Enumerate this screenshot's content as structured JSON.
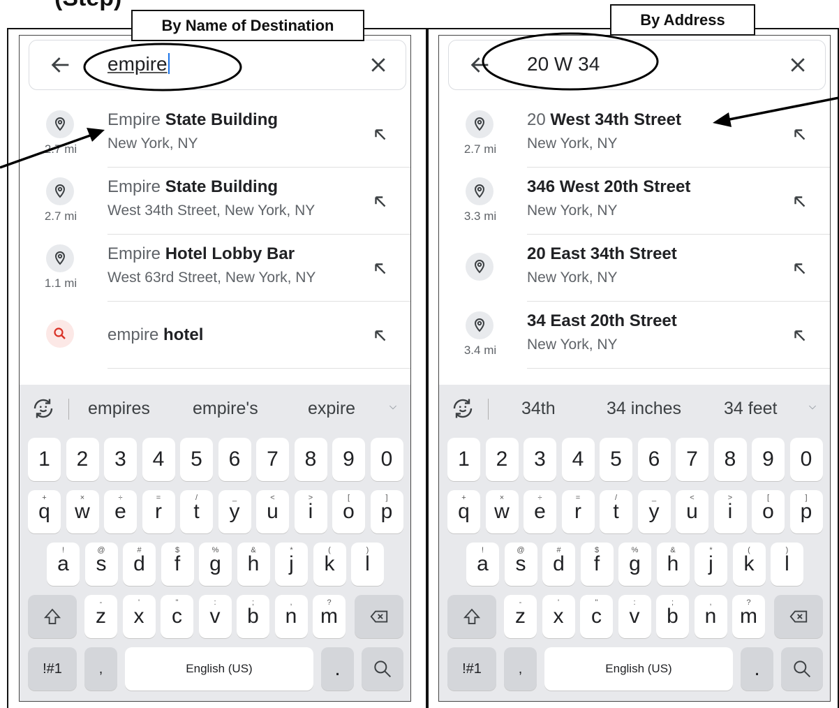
{
  "heading_fragment": "(Step)",
  "panels": [
    {
      "label": "By Name of Destination",
      "search": {
        "query": "empire"
      },
      "results": [
        {
          "title_highlight": "Empire",
          "title_rest": " State Building",
          "subtitle": "New York, NY",
          "distance": "2.7 mi",
          "icon": "map-pin-icon"
        },
        {
          "title_highlight": "Empire",
          "title_rest": " State Building",
          "subtitle": "West 34th Street, New York, NY",
          "distance": "2.7 mi",
          "icon": "map-pin-icon"
        },
        {
          "title_highlight": "Empire",
          "title_rest": " Hotel Lobby Bar",
          "subtitle": "West 63rd Street, New York, NY",
          "distance": "1.1 mi",
          "icon": "map-pin-icon"
        },
        {
          "title_highlight": "empire",
          "title_rest": " hotel",
          "subtitle": "",
          "distance": "",
          "icon": "search-icon"
        }
      ],
      "suggestions": [
        "empires",
        "empire's",
        "expire"
      ]
    },
    {
      "label": "By Address",
      "search": {
        "query": "20 W 34"
      },
      "results": [
        {
          "title_highlight": "20",
          "title_rest": " West 34th Street",
          "subtitle": "New York, NY",
          "distance": "2.7 mi",
          "icon": "map-pin-icon"
        },
        {
          "title_highlight": "",
          "title_rest": "346 West 20th Street",
          "subtitle": "New York, NY",
          "distance": "3.3 mi",
          "icon": "map-pin-icon"
        },
        {
          "title_highlight": "",
          "title_rest": "20 East 34th Street",
          "subtitle": "New York, NY",
          "distance": "",
          "icon": "map-pin-icon"
        },
        {
          "title_highlight": "",
          "title_rest": "34 East 20th Street",
          "subtitle": "New York, NY",
          "distance": "3.4 mi",
          "icon": "map-pin-icon"
        }
      ],
      "suggestions": [
        "34th",
        "34 inches",
        "34 feet"
      ]
    }
  ],
  "keyboard": {
    "numbers": [
      "1",
      "2",
      "3",
      "4",
      "5",
      "6",
      "7",
      "8",
      "9",
      "0"
    ],
    "row_q": [
      "q",
      "w",
      "e",
      "r",
      "t",
      "y",
      "u",
      "i",
      "o",
      "p"
    ],
    "row_q_sup": [
      "+",
      "×",
      "÷",
      "=",
      "/",
      "_",
      "<",
      ">",
      "[",
      "]"
    ],
    "row_a": [
      "a",
      "s",
      "d",
      "f",
      "g",
      "h",
      "j",
      "k",
      "l"
    ],
    "row_a_sup": [
      "!",
      "@",
      "#",
      "$",
      "%",
      "&",
      "*",
      "(",
      ")"
    ],
    "row_z": [
      "z",
      "x",
      "c",
      "v",
      "b",
      "n",
      "m"
    ],
    "row_z_sup": [
      "-",
      "'",
      "\"",
      ":",
      ";",
      ",",
      "?"
    ],
    "symbols_key": "!#1",
    "comma_key": ",",
    "space_label": "English (US)",
    "period_key": ".",
    "icons": {
      "shift": "shift-icon",
      "backspace": "backspace-icon",
      "search": "search-key-icon",
      "emoji": "emoji-icon"
    }
  },
  "colors": {
    "caret": "#1a73e8",
    "search_badge": "#fce8e6",
    "pin_badge": "#e8eaed",
    "keyboard_bg": "#e8e9ec"
  }
}
